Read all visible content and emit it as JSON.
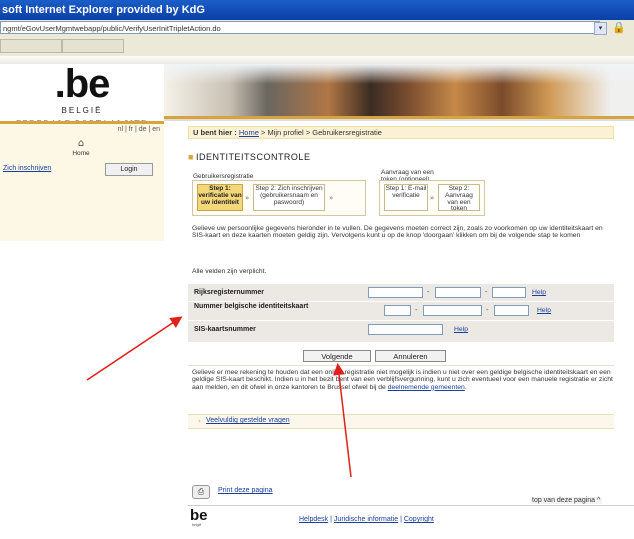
{
  "browser": {
    "title": "soft Internet Explorer provided by KdG",
    "url": "ngmt/eGovUserMgmtwebapp/public/VerifyUserInitTripletAction.do"
  },
  "branding": {
    "logo_text": ".be",
    "country": "BELGIË",
    "portal_name": "FEDERALE PORTAALSITE"
  },
  "sidebar": {
    "languages": "nl | fr | de | en",
    "home_label": "Home",
    "register_link": "Zich inschrijven",
    "login_button": "Login"
  },
  "breadcrumb": {
    "prefix": "U bent hier :",
    "home": "Home",
    "separator": ">",
    "profile": "Mijn profiel",
    "current": "Gebruikersregistratie"
  },
  "section": {
    "title": "IDENTITEITSCONTROLE"
  },
  "steps": {
    "group1_label": "Gebruikersregistratie",
    "group2_label": "Aanvraag van een token (optioneel)",
    "items": [
      {
        "label": "Step 1: verificatie van uw identiteit"
      },
      {
        "label": "Step 2: Zich inschrijven (gebruikersnaam en paswoord)"
      },
      {
        "label": "Step 1: E-mail verificatie"
      },
      {
        "label": "Step 2: Aanvraag van een token"
      }
    ],
    "arrow": "»"
  },
  "intro_text": "Gelieve uw persoonlijke gegevens hieronder in te vullen. De gegevens moeten correct zijn, zoals zo voorkomen op uw identiteitskaart en SIS-kaart en deze kaarten moeten geldig zijn. Vervolgens kunt u op de knop 'doorgaan' klikken om bij de volgende stap te komen",
  "required_text": "Alle velden zijn verplicht.",
  "form": {
    "fields": [
      {
        "label": "Rijksregisternummer",
        "help": "Help"
      },
      {
        "label": "Nummer belgische identiteitskaart",
        "help": "Help"
      },
      {
        "label": "SIS-kaartsnummer",
        "help": "Help"
      }
    ],
    "dash": "-"
  },
  "buttons": {
    "next": "Volgende",
    "cancel": "Annuleren"
  },
  "note": {
    "text": "Gelieve er mee rekening te houden dat een online registratie niet mogelijk is indien u niet over een geldige belgische identiteitskaart en een geldige SIS-kaart beschikt. Indien u in het bezit bent van een verblijfsvergunning, kunt u zich eventueel voor een manuele registratie er zicht aan melden, en dit ofwel in onze kantoren te Brussel ofwel bij de",
    "link": "deelnemende gemeenten",
    "end": "."
  },
  "faq_link": "Veelvuldig gestelde vragen",
  "print_link": "Print deze pagina",
  "top_link": "top van deze pagina ^",
  "footer": {
    "logo": "be",
    "logo_sub": "belgië",
    "helpdesk": "Helpdesk",
    "legal": "Juridische informatie",
    "copyright": "Copyright",
    "separator": "|"
  },
  "colors": {
    "gold": "#d7a33d",
    "link": "#1a3e9c",
    "annotation": "#e0201b"
  }
}
